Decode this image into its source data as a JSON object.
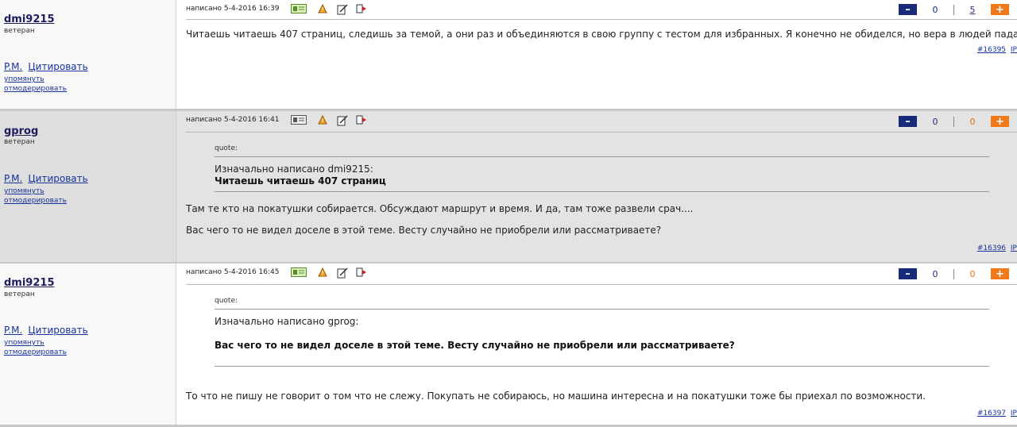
{
  "posts": [
    {
      "author": "dmi9215",
      "rank": "ветеран",
      "links": {
        "pm": "P.M.",
        "quote": "Цитировать",
        "mention": "упомянуть",
        "moderate": "отмодерировать"
      },
      "timestamp": "написано 5-4-2016 16:39",
      "votes": {
        "minus": "–",
        "down": "0",
        "up": "5",
        "plus": "+"
      },
      "text": "Читаешь читаешь 407 страниц, следишь за темой, а они раз и объединяются в свою группу с тестом для избранных. Я конечно не обиделся, но вера в людей падает(((",
      "post_number": "#16395",
      "ip": "IP"
    },
    {
      "author": "gprog",
      "rank": "ветеран",
      "links": {
        "pm": "P.M.",
        "quote": "Цитировать",
        "mention": "упомянуть",
        "moderate": "отмодерировать"
      },
      "timestamp": "написано 5-4-2016 16:41",
      "votes": {
        "minus": "–",
        "down": "0",
        "up": "0",
        "plus": "+"
      },
      "quote": {
        "label": "quote:",
        "author": "Изначально написано dmi9215:",
        "text": "Читаешь читаешь 407 страниц"
      },
      "paragraphs": [
        "Там те кто на покатушки собирается. Обсуждают маршрут и время. И да, там тоже развели срач....",
        "Вас чего то не видел доселе в этой теме. Весту случайно не приобрели или рассматриваете?"
      ],
      "post_number": "#16396",
      "ip": "IP"
    },
    {
      "author": "dmi9215",
      "rank": "ветеран",
      "links": {
        "pm": "P.M.",
        "quote": "Цитировать",
        "mention": "упомянуть",
        "moderate": "отмодерировать"
      },
      "timestamp": "написано 5-4-2016 16:45",
      "votes": {
        "minus": "–",
        "down": "0",
        "up": "0",
        "plus": "+"
      },
      "quote": {
        "label": "quote:",
        "author": "Изначально написано gprog:",
        "text": "Вас чего то не видел доселе в этой теме. Весту случайно не приобрели или рассматриваете?"
      },
      "text": "То что не пишу не говорит о том что не слежу. Покупать не собираюсь, но машина интересна и на покатушки тоже бы приехал по возможности.",
      "post_number": "#16397",
      "ip": "IP"
    }
  ],
  "icons": [
    "profile-icon",
    "warning-icon",
    "edit-icon",
    "reply-icon"
  ],
  "colors": {
    "minus_button": "#182a78",
    "plus_button": "#ee7a1b",
    "link": "#15339a",
    "username": "#1c1f5c"
  }
}
